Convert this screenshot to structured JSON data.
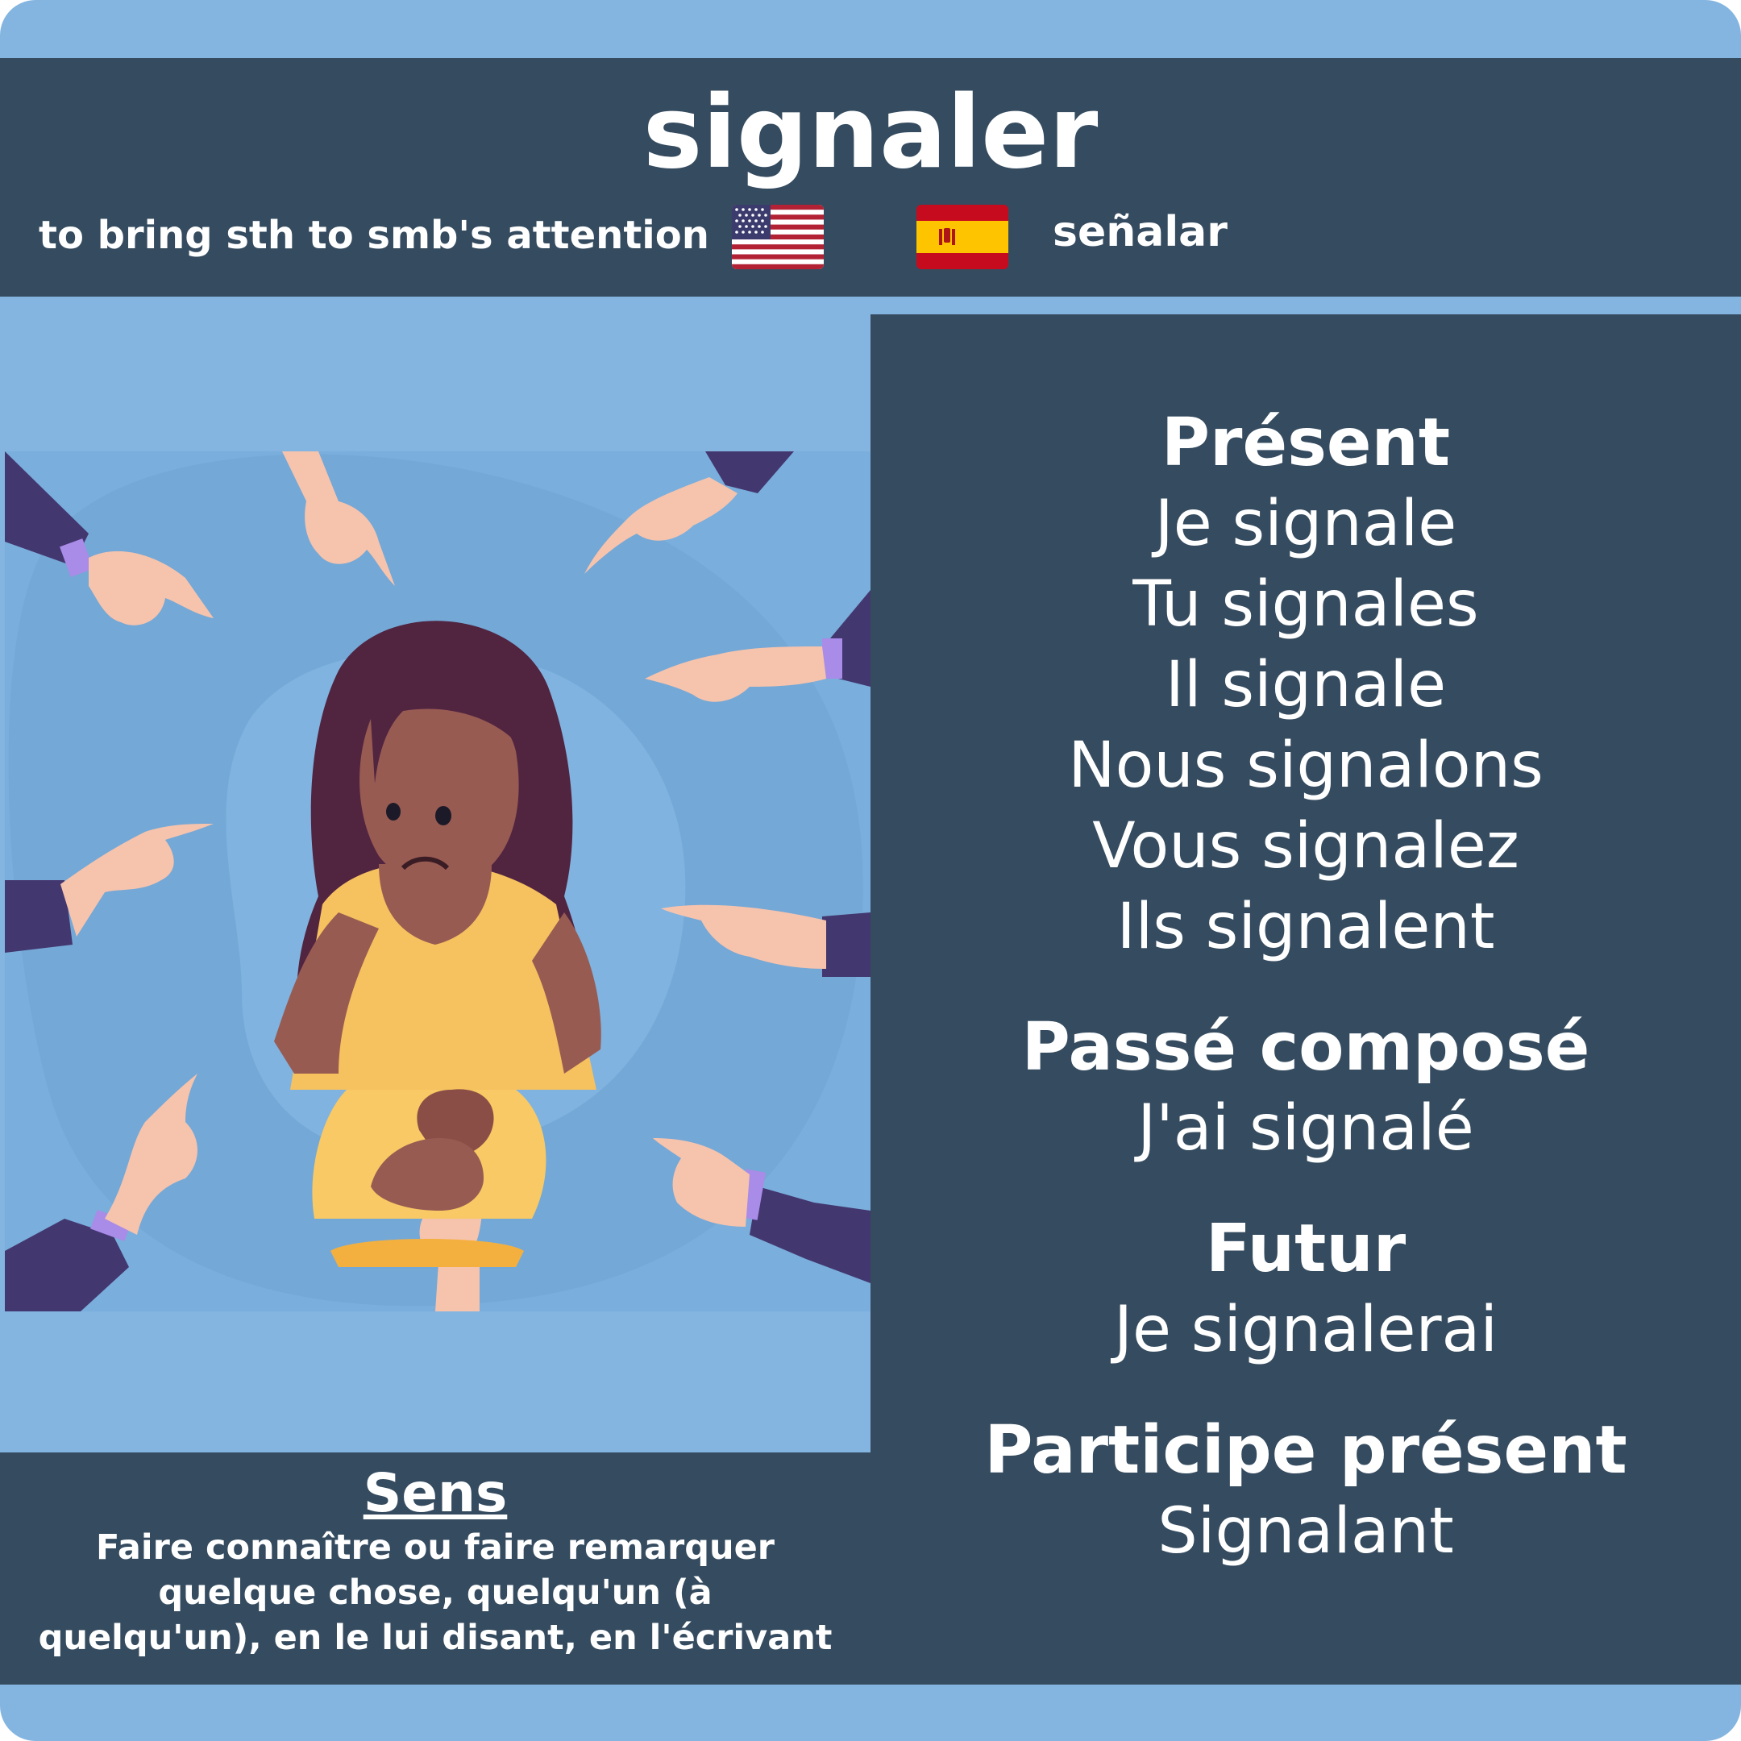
{
  "verb": "signaler",
  "english": {
    "translation": "to bring sth to smb's attention",
    "flag": "us-flag-icon"
  },
  "spanish": {
    "translation": "señalar",
    "flag": "spain-flag-icon"
  },
  "illustration": {
    "description_icon": "woman-pointed-at-illustration"
  },
  "conjugation": {
    "present": {
      "heading": "Présent",
      "forms": [
        "Je signale",
        "Tu signales",
        "Il signale",
        "Nous signalons",
        "Vous signalez",
        "Ils signalent"
      ]
    },
    "passe_compose": {
      "heading": "Passé composé",
      "form": "J'ai signalé"
    },
    "futur": {
      "heading": "Futur",
      "form": "Je signalerai"
    },
    "participe_present": {
      "heading": "Participe présent",
      "form": "Signalant"
    }
  },
  "sens": {
    "title": "Sens",
    "lines": [
      "Faire connaître ou faire remarquer",
      "quelque chose, quelqu'un (à",
      "quelqu'un), en le lui disant, en l'écrivant"
    ]
  },
  "colors": {
    "background": "#84b5e0",
    "panel": "#354b5f",
    "text": "#ffffff"
  }
}
